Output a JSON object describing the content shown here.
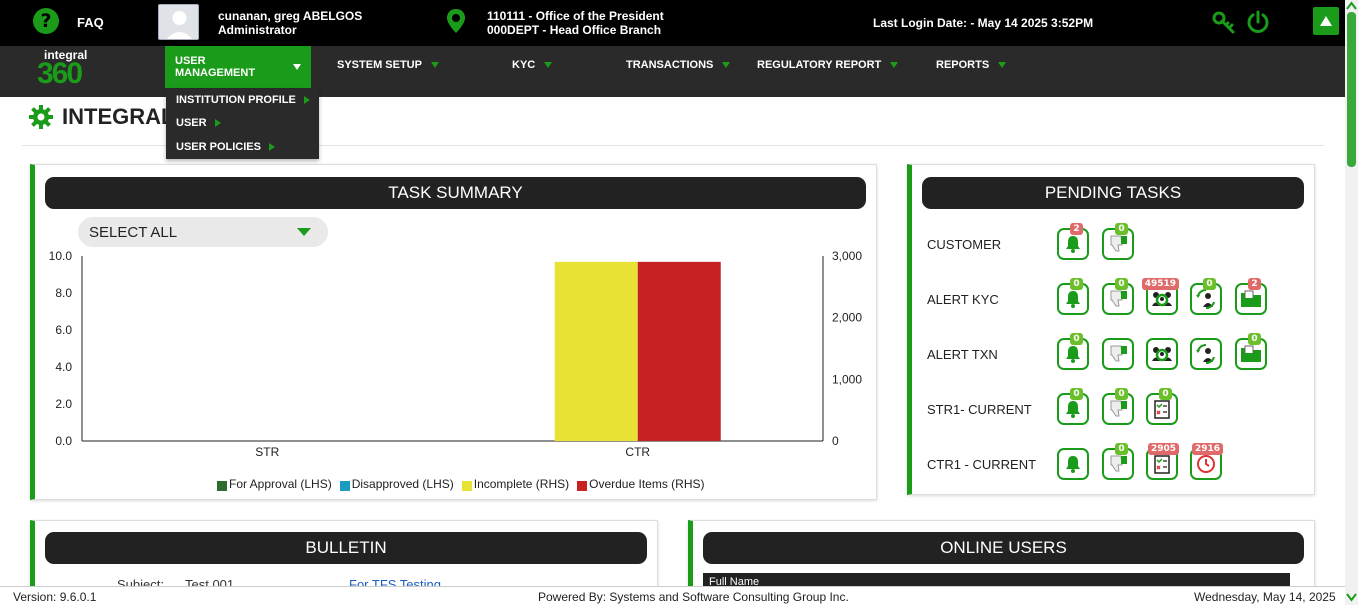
{
  "topbar": {
    "faq_label": "FAQ",
    "user_name": "cunanan, greg ABELGOS",
    "user_role": "Administrator",
    "office_line1": "110111 - Office of the President",
    "office_line2": "000DEPT - Head Office Branch",
    "last_login": "Last Login Date: - May 14 2025 3:52PM"
  },
  "nav": {
    "logo_text": "integral",
    "logo_number": "360",
    "items": [
      {
        "label": "USER MANAGEMENT",
        "active": true
      },
      {
        "label": "SYSTEM SETUP"
      },
      {
        "label": "KYC"
      },
      {
        "label": "TRANSACTIONS"
      },
      {
        "label": "REGULATORY REPORT"
      },
      {
        "label": "REPORTS"
      }
    ],
    "dropdown": [
      "INSTITUTION PROFILE",
      "USER",
      "USER POLICIES"
    ]
  },
  "page": {
    "title": "INTEGRAL"
  },
  "task_summary": {
    "header": "TASK SUMMARY",
    "select_value": "SELECT ALL"
  },
  "chart_data": {
    "type": "bar",
    "categories": [
      "STR",
      "CTR"
    ],
    "series": [
      {
        "name": "For Approval (LHS)",
        "axis": "left",
        "color": "#2e6b2e",
        "values": [
          0,
          0
        ]
      },
      {
        "name": "Disapproved (LHS)",
        "axis": "left",
        "color": "#1a9bbf",
        "values": [
          0,
          0
        ]
      },
      {
        "name": "Incomplete (RHS)",
        "axis": "right",
        "color": "#e8e235",
        "values": [
          0,
          2905
        ]
      },
      {
        "name": "Overdue Items (RHS)",
        "axis": "right",
        "color": "#c62222",
        "values": [
          0,
          2905
        ]
      }
    ],
    "ylim_left": [
      0,
      10
    ],
    "yticks_left": [
      "0.0",
      "2.0",
      "4.0",
      "6.0",
      "8.0",
      "10.0"
    ],
    "ylim_right": [
      0,
      3000
    ],
    "yticks_right": [
      "0",
      "1,000",
      "2,000",
      "3,000"
    ],
    "legend": "bottom",
    "grid": false
  },
  "pending_tasks": {
    "header": "PENDING TASKS",
    "rows": [
      {
        "label": "CUSTOMER",
        "icons": [
          {
            "icon": "bell-icon",
            "badge": "2",
            "badge_color": "red"
          },
          {
            "icon": "thumbs-down-icon",
            "badge": "0",
            "badge_color": "green"
          }
        ]
      },
      {
        "label": "ALERT KYC",
        "icons": [
          {
            "icon": "bell-icon",
            "badge": "0",
            "badge_color": "green"
          },
          {
            "icon": "thumbs-down-icon",
            "badge": "0",
            "badge_color": "green"
          },
          {
            "icon": "investigate-icon",
            "badge": "49519",
            "badge_color": "red"
          },
          {
            "icon": "reassign-icon",
            "badge": "0",
            "badge_color": "green"
          },
          {
            "icon": "folder-icon",
            "badge": "2",
            "badge_color": "red"
          }
        ]
      },
      {
        "label": "ALERT TXN",
        "icons": [
          {
            "icon": "bell-icon",
            "badge": "0",
            "badge_color": "green"
          },
          {
            "icon": "thumbs-down-icon",
            "badge": "",
            "badge_color": "green"
          },
          {
            "icon": "investigate-icon",
            "badge": "",
            "badge_color": "red"
          },
          {
            "icon": "reassign-icon",
            "badge": "",
            "badge_color": "green"
          },
          {
            "icon": "folder-icon",
            "badge": "0",
            "badge_color": "green"
          }
        ]
      },
      {
        "label": "STR1- CURRENT",
        "icons": [
          {
            "icon": "bell-icon",
            "badge": "0",
            "badge_color": "green"
          },
          {
            "icon": "thumbs-down-icon",
            "badge": "0",
            "badge_color": "green"
          },
          {
            "icon": "checklist-icon",
            "badge": "0",
            "badge_color": "green"
          }
        ]
      },
      {
        "label": "CTR1 - CURRENT",
        "icons": [
          {
            "icon": "bell-icon",
            "badge": "",
            "badge_color": "green"
          },
          {
            "icon": "thumbs-down-icon",
            "badge": "0",
            "badge_color": "green"
          },
          {
            "icon": "checklist-icon",
            "badge": "2905",
            "badge_color": "red"
          },
          {
            "icon": "clock-icon",
            "badge": "2916",
            "badge_color": "red"
          }
        ]
      }
    ]
  },
  "bulletin": {
    "header": "BULLETIN",
    "subject_label": "Subject:",
    "subject_value": "Test 001",
    "link_text": "For TFS Testing"
  },
  "online_users": {
    "header": "ONLINE USERS",
    "col1": "Full Name"
  },
  "footer": {
    "version": "Version: 9.6.0.1",
    "powered_by": "Powered By: Systems and Software Consulting Group Inc.",
    "date": "Wednesday, May 14, 2025"
  }
}
